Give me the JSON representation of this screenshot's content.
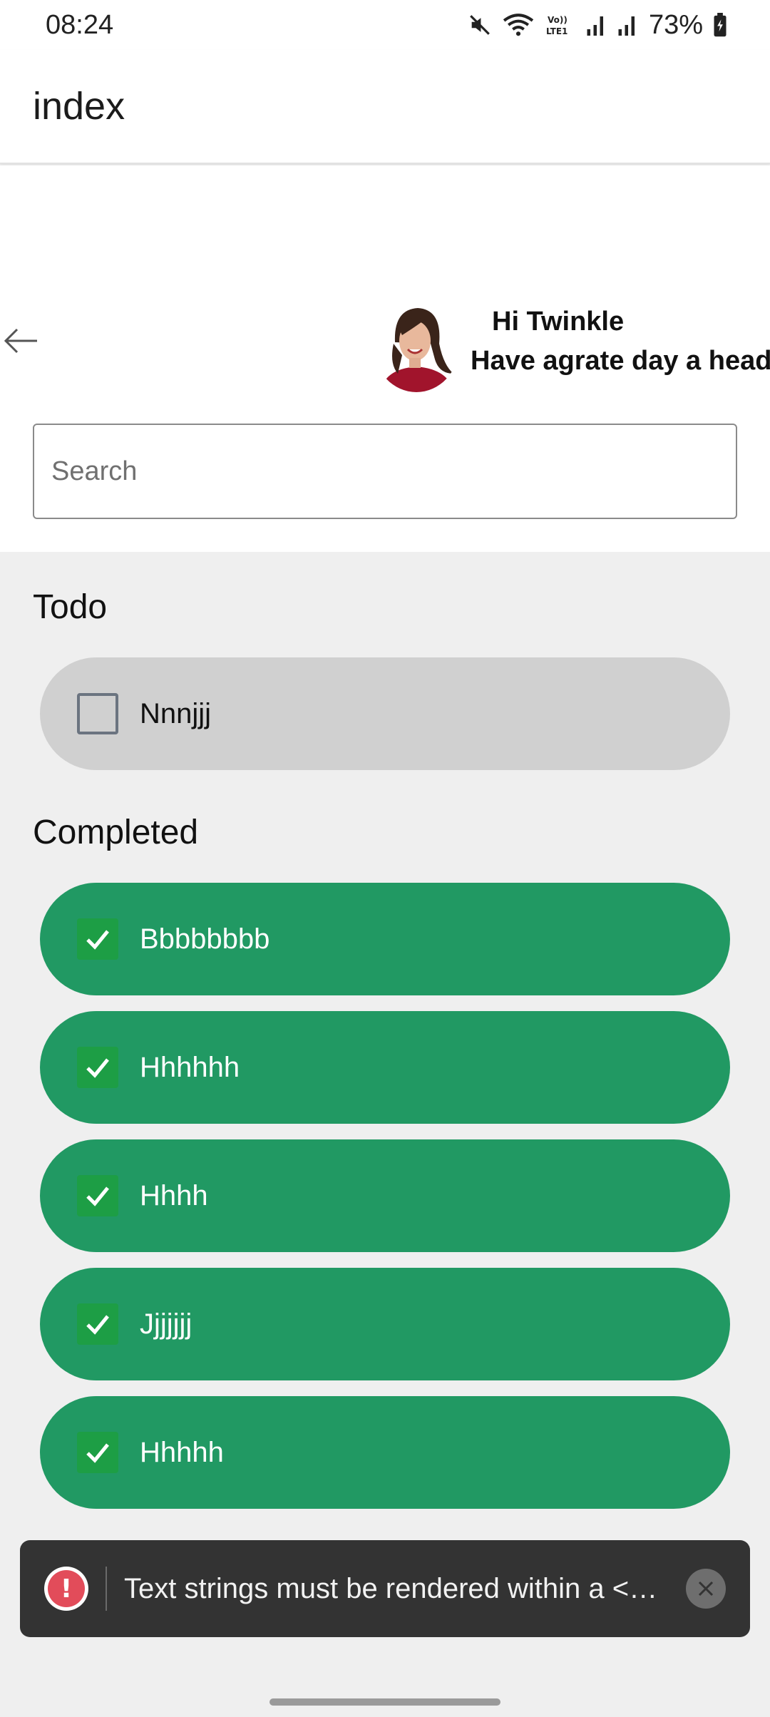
{
  "status_bar": {
    "time": "08:24",
    "battery": "73%",
    "network_label": "Vo)) LTE1",
    "icons": [
      "mute-icon",
      "wifi-icon",
      "volte-icon",
      "signal-icon",
      "signal-icon",
      "battery-icon"
    ]
  },
  "header": {
    "title": "index"
  },
  "greeting": {
    "name_line": "Hi Twinkle",
    "message": "Have agrate day a head"
  },
  "search": {
    "placeholder": "Search",
    "value": ""
  },
  "todo_section": {
    "title": "Todo",
    "items": [
      {
        "label": "Nnnjjj",
        "checked": false
      }
    ]
  },
  "completed_section": {
    "title": "Completed",
    "items": [
      {
        "label": "Bbbbbbbb",
        "checked": true
      },
      {
        "label": "Hhhhhh",
        "checked": true
      },
      {
        "label": "Hhhh",
        "checked": true
      },
      {
        "label": "Jjjjjjj",
        "checked": true
      },
      {
        "label": "Hhhhh",
        "checked": true
      }
    ]
  },
  "toast": {
    "message": "Text strings must be rendered within a <T..."
  },
  "colors": {
    "completed_pill": "#219963",
    "pending_pill": "#d0d0d0",
    "checkbox_checked": "#1d9e45",
    "toast_bg": "#333333",
    "error_icon": "#e24c5a"
  }
}
